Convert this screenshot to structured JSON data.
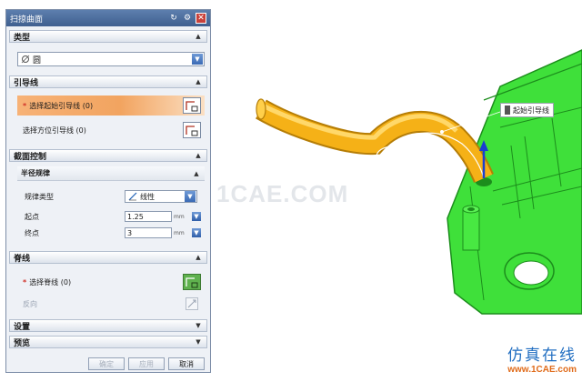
{
  "dialog": {
    "title": "扫掠曲面",
    "sections": {
      "type": "类型",
      "guide": "引导线",
      "section_control": "截面控制",
      "spine": "脊线",
      "settings": "设置",
      "preview": "预览"
    },
    "type_dropdown": {
      "value": "圆",
      "icon": "circle-type-icon"
    },
    "guide": {
      "start_guide": "选择起始引导线 (0)",
      "orient_guide": "选择方位引导线 (0)"
    },
    "radius_law": {
      "title": "半径规律",
      "law_type_label": "规律类型",
      "law_type_value": "线性",
      "start_label": "起点",
      "start_value": "1.25",
      "end_label": "终点",
      "end_value": "3",
      "unit": "mm"
    },
    "spine": {
      "select": "选择脊线 (0)",
      "reverse": "反向"
    },
    "buttons": {
      "ok": "确定",
      "apply": "应用",
      "cancel": "取消"
    }
  },
  "scene": {
    "callout": "起始引导线",
    "watermark": "1CAE.COM",
    "brand_cn": "仿真在线",
    "brand_url": "www.1CAE.com"
  },
  "colors": {
    "active_row": "#f2a460",
    "pipe": "#f5b117",
    "part": "#3fe03a",
    "select_green": "#5fb14e",
    "title_bar": "#4a6a9a",
    "brand_blue": "#1f6dc1",
    "brand_orange": "#e06b1a"
  }
}
